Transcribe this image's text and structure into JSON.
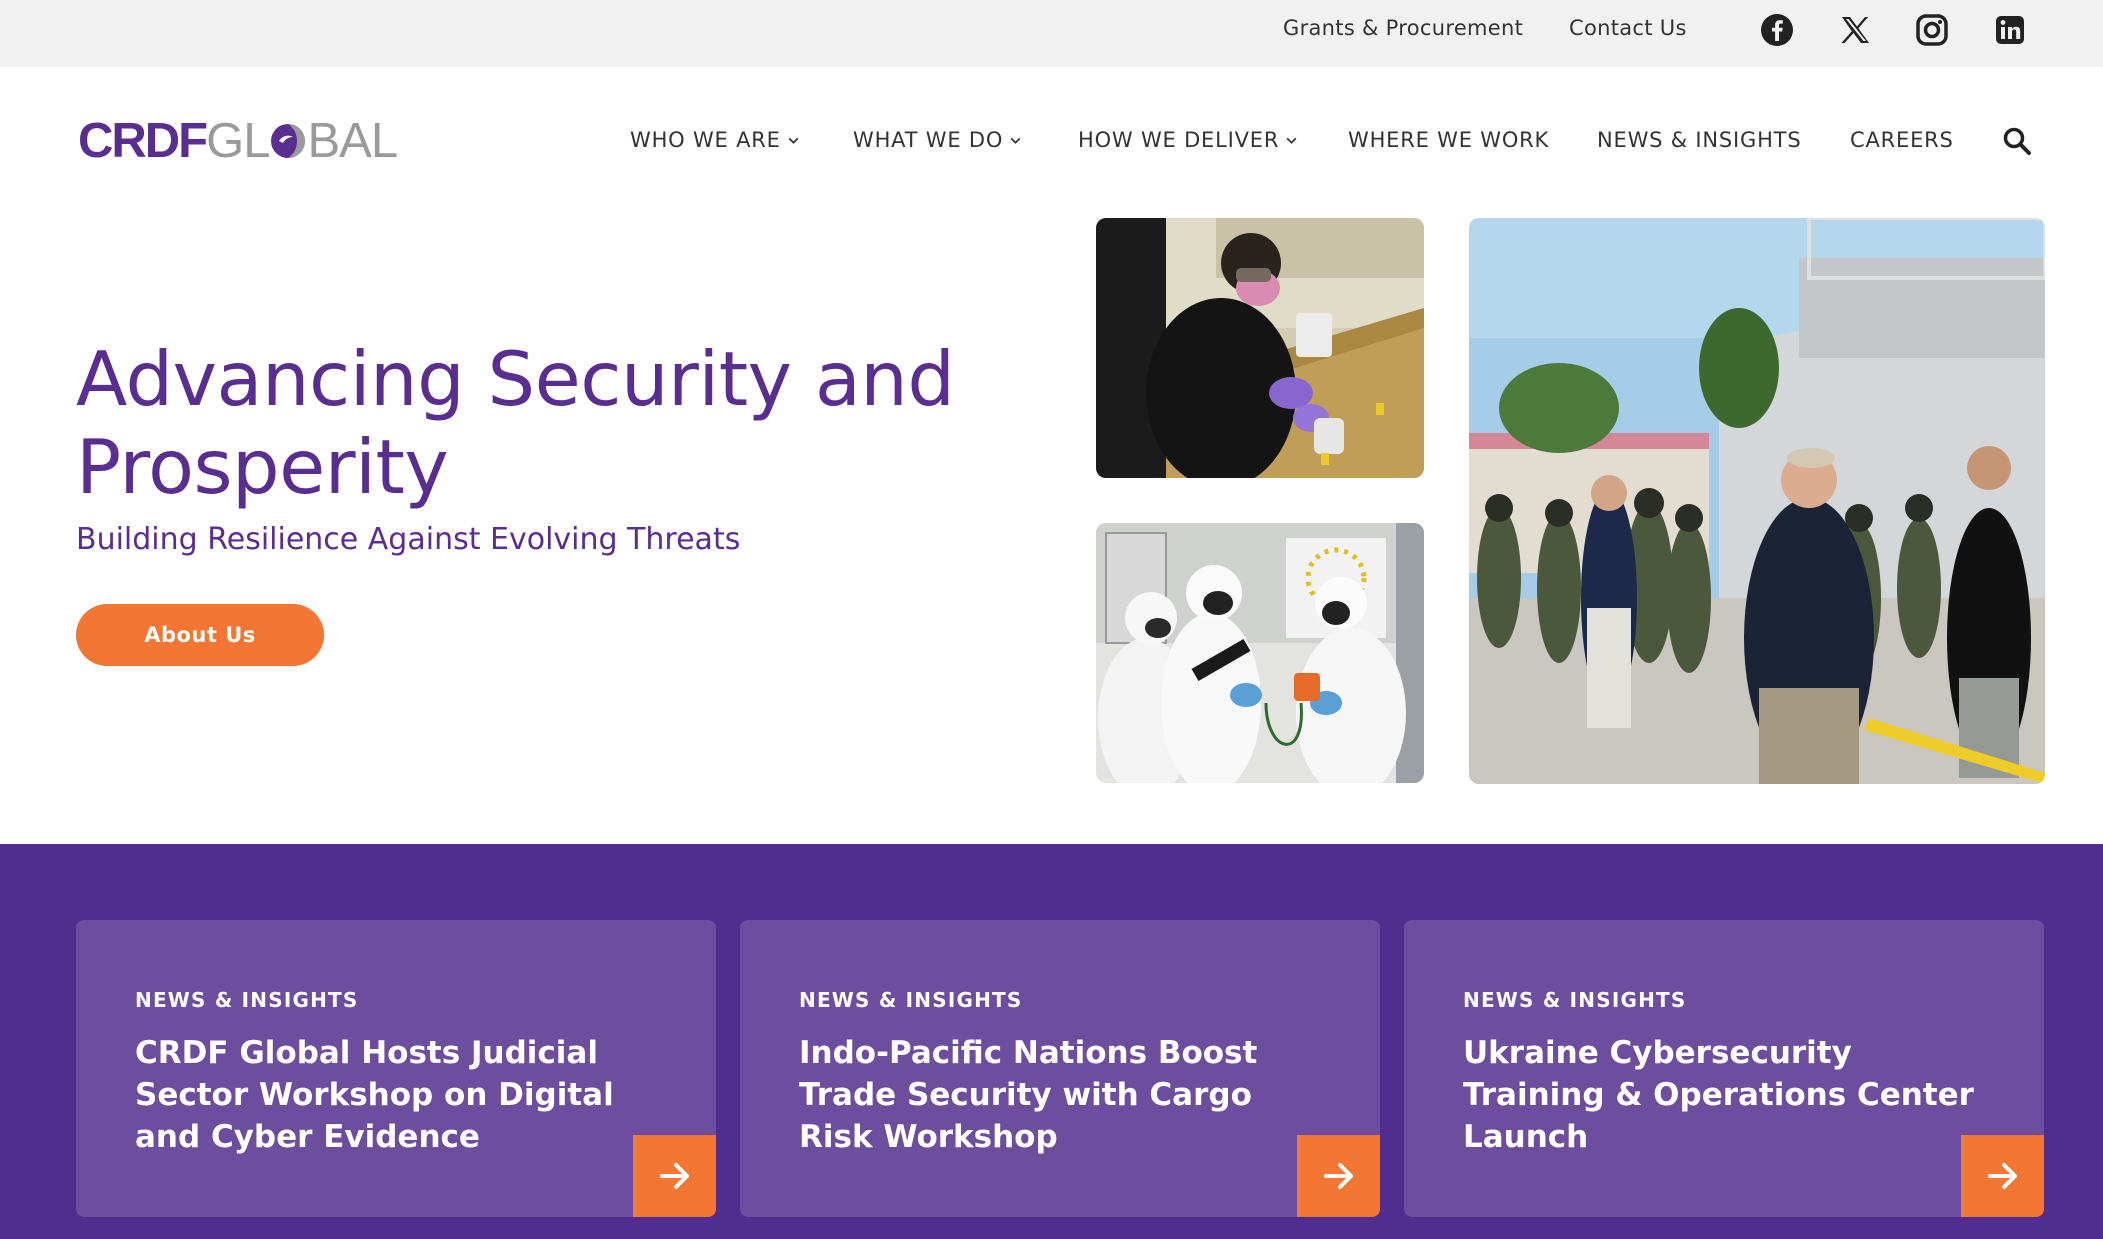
{
  "utility": {
    "grants_label": "Grants & Procurement",
    "contact_label": "Contact Us",
    "social": [
      "facebook-icon",
      "x-icon",
      "instagram-icon",
      "linkedin-icon"
    ]
  },
  "header": {
    "logo_crdf": "CRDF",
    "logo_global_pre": "GL",
    "logo_global_post": "BAL",
    "nav": [
      {
        "label": "WHO WE ARE",
        "has_dropdown": true
      },
      {
        "label": "WHAT WE DO",
        "has_dropdown": true
      },
      {
        "label": "HOW WE DELIVER",
        "has_dropdown": true
      },
      {
        "label": "WHERE WE WORK",
        "has_dropdown": false
      },
      {
        "label": "NEWS & INSIGHTS",
        "has_dropdown": false
      },
      {
        "label": "CAREERS",
        "has_dropdown": false
      }
    ],
    "search_icon": "search-icon"
  },
  "hero": {
    "title": "Advancing Security and Prosperity",
    "subtitle": "Building Resilience Against Evolving Threats",
    "cta_label": "About Us"
  },
  "news": [
    {
      "kicker": "NEWS & INSIGHTS",
      "title": "CRDF Global Hosts Judicial Sector Workshop on Digital and Cyber Evidence"
    },
    {
      "kicker": "NEWS & INSIGHTS",
      "title": "Indo-Pacific Nations Boost Trade Security with Cargo Risk Workshop"
    },
    {
      "kicker": "NEWS & INSIGHTS",
      "title": "Ukraine Cybersecurity Training & Operations Center Launch"
    }
  ],
  "colors": {
    "brand_purple": "#5a2d91",
    "band_purple": "#512d8f",
    "card_purple": "#6c4d9e",
    "accent_orange": "#f37632"
  }
}
